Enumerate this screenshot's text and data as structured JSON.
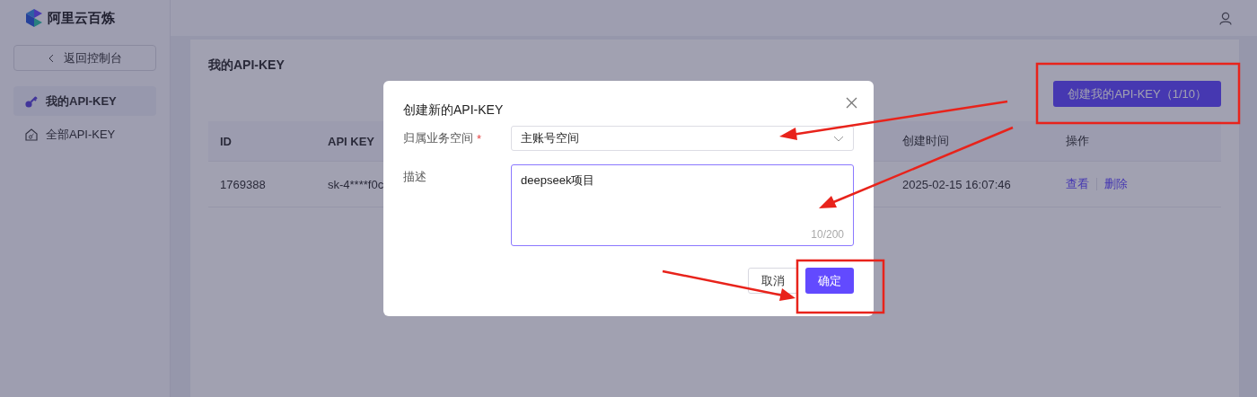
{
  "app": {
    "name": "阿里云百炼"
  },
  "sidebar": {
    "back_button": "返回控制台",
    "items": [
      {
        "label": "我的API-KEY",
        "kind": "key",
        "selected": true
      },
      {
        "label": "全部API-KEY",
        "kind": "house",
        "selected": false
      }
    ]
  },
  "page": {
    "title": "我的API-KEY",
    "create_button": "创建我的API-KEY（1/10）",
    "table": {
      "columns": [
        "ID",
        "API KEY",
        "创建时间",
        "操作"
      ],
      "rows": [
        {
          "cells": [
            "1769388",
            "sk-4****f0c",
            "2025-02-15 16:07:46"
          ],
          "actions": [
            "查看",
            "删除"
          ]
        }
      ]
    }
  },
  "dialog": {
    "title": "创建新的API-KEY",
    "fields": [
      {
        "kind": "select",
        "label": "归属业务空间",
        "required_mark": "*",
        "focused": false,
        "value": "主账号空间"
      },
      {
        "kind": "textarea",
        "label": "描述",
        "focused": true,
        "value": "deepseek项目",
        "counter": "10/200"
      }
    ],
    "buttons": [
      {
        "label": "取消",
        "kind": "secondary"
      },
      {
        "label": "确定",
        "kind": "primary"
      }
    ]
  }
}
